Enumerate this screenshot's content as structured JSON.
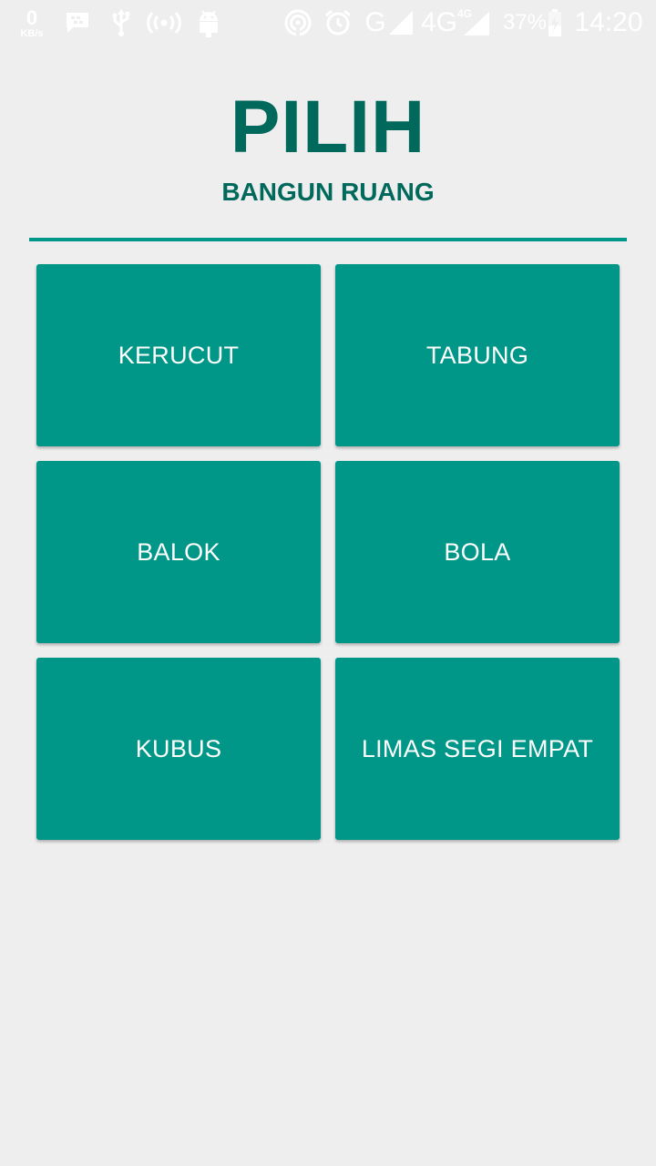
{
  "status_bar": {
    "net_speed_value": "0",
    "net_speed_unit": "KB/s",
    "network_label": "G",
    "network_4g_label": "4G",
    "network_4g_small_label": "4G",
    "battery_percent": "37%",
    "time": "14:20",
    "icons": [
      "bbm-icon",
      "usb-icon",
      "hotspot-icon",
      "android-debug-icon",
      "wifi-hotspot-icon",
      "alarm-icon",
      "signal-icon",
      "signal-4g-icon",
      "battery-charging-icon"
    ]
  },
  "header": {
    "title": "PILIH",
    "subtitle": "BANGUN RUANG"
  },
  "colors": {
    "accent": "#009688",
    "title": "#00695c",
    "background": "#eeeeee",
    "button_text": "#ffffff"
  },
  "shapes": [
    {
      "label": "KERUCUT"
    },
    {
      "label": "TABUNG"
    },
    {
      "label": "BALOK"
    },
    {
      "label": "BOLA"
    },
    {
      "label": "KUBUS"
    },
    {
      "label": "LIMAS SEGI EMPAT"
    }
  ]
}
